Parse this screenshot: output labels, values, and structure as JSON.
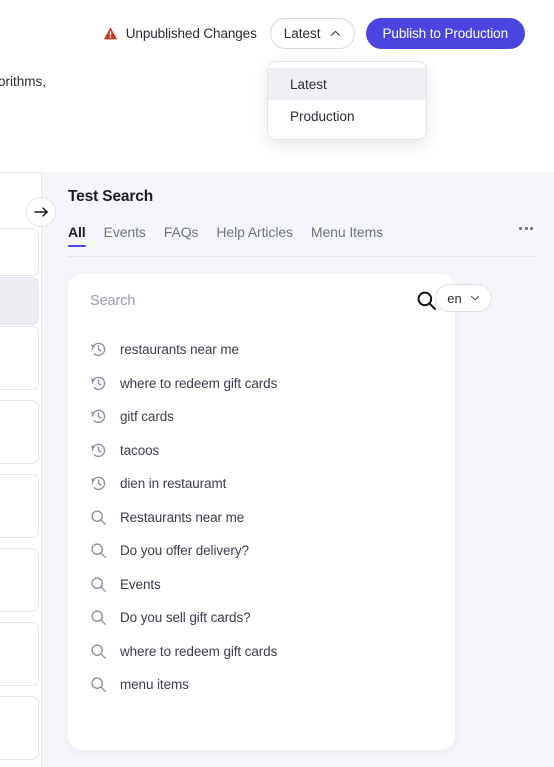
{
  "topbar": {
    "warning_icon": "warning-triangle-icon",
    "unpublished_label": "Unpublished Changes",
    "env_select_value": "Latest",
    "env_select_chevron": "chevron-up-icon",
    "publish_label": "Publish to Production",
    "accent_color": "#4a45e0",
    "warning_color": "#c63a1e"
  },
  "env_menu": {
    "items": [
      {
        "label": "Latest",
        "selected": true
      },
      {
        "label": "Production",
        "selected": false
      }
    ]
  },
  "background": {
    "clipped_text": "orithms,"
  },
  "panel": {
    "title": "Test Search",
    "collapse_icon": "arrow-right-icon",
    "overflow_icon": "more-horizontal-icon",
    "tabs": [
      {
        "label": "All",
        "active": true
      },
      {
        "label": "Events",
        "active": false
      },
      {
        "label": "FAQs",
        "active": false
      },
      {
        "label": "Help Articles",
        "active": false
      },
      {
        "label": "Menu Items",
        "active": false
      }
    ]
  },
  "search": {
    "placeholder": "Search",
    "value": "",
    "submit_icon": "search-icon",
    "language": "en",
    "language_chevron": "chevron-down-icon",
    "suggestions": [
      {
        "text": "restaurants near me",
        "icon": "history-icon"
      },
      {
        "text": "where to redeem gift cards",
        "icon": "history-icon"
      },
      {
        "text": "gitf cards",
        "icon": "history-icon"
      },
      {
        "text": "tacoos",
        "icon": "history-icon"
      },
      {
        "text": "dien in restauramt",
        "icon": "history-icon"
      },
      {
        "text": "Restaurants near me",
        "icon": "search-icon"
      },
      {
        "text": "Do you offer delivery?",
        "icon": "search-icon"
      },
      {
        "text": "Events",
        "icon": "search-icon"
      },
      {
        "text": "Do you sell gift cards?",
        "icon": "search-icon"
      },
      {
        "text": "where to redeem gift cards",
        "icon": "search-icon"
      },
      {
        "text": "menu items",
        "icon": "search-icon"
      }
    ]
  }
}
